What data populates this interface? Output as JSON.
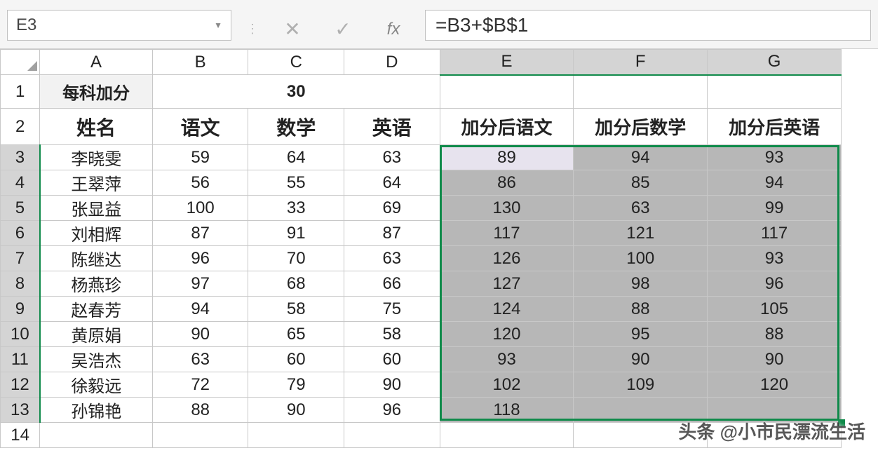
{
  "nameBox": "E3",
  "formula": "=B3+$B$1",
  "fxLabel": "fx",
  "columns": [
    "A",
    "B",
    "C",
    "D",
    "E",
    "F",
    "G"
  ],
  "rowNumbers": [
    "1",
    "2",
    "3",
    "4",
    "5",
    "6",
    "7",
    "8",
    "9",
    "10",
    "11",
    "12",
    "13",
    "14"
  ],
  "row1": {
    "A": "每科加分",
    "BCD": "30"
  },
  "headers": {
    "A": "姓名",
    "B": "语文",
    "C": "数学",
    "D": "英语",
    "E": "加分后语文",
    "F": "加分后数学",
    "G": "加分后英语"
  },
  "students": [
    {
      "name": "李晓雯",
      "b": "59",
      "c": "64",
      "d": "63",
      "e": "89",
      "f": "94",
      "g": "93"
    },
    {
      "name": "王翠萍",
      "b": "56",
      "c": "55",
      "d": "64",
      "e": "86",
      "f": "85",
      "g": "94"
    },
    {
      "name": "张显益",
      "b": "100",
      "c": "33",
      "d": "69",
      "e": "130",
      "f": "63",
      "g": "99"
    },
    {
      "name": "刘相辉",
      "b": "87",
      "c": "91",
      "d": "87",
      "e": "117",
      "f": "121",
      "g": "117"
    },
    {
      "name": "陈继达",
      "b": "96",
      "c": "70",
      "d": "63",
      "e": "126",
      "f": "100",
      "g": "93"
    },
    {
      "name": "杨燕珍",
      "b": "97",
      "c": "68",
      "d": "66",
      "e": "127",
      "f": "98",
      "g": "96"
    },
    {
      "name": "赵春芳",
      "b": "94",
      "c": "58",
      "d": "75",
      "e": "124",
      "f": "88",
      "g": "105"
    },
    {
      "name": "黄原娟",
      "b": "90",
      "c": "65",
      "d": "58",
      "e": "120",
      "f": "95",
      "g": "88"
    },
    {
      "name": "吴浩杰",
      "b": "63",
      "c": "60",
      "d": "60",
      "e": "93",
      "f": "90",
      "g": "90"
    },
    {
      "name": "徐毅远",
      "b": "72",
      "c": "79",
      "d": "90",
      "e": "102",
      "f": "109",
      "g": "120"
    },
    {
      "name": "孙锦艳",
      "b": "88",
      "c": "90",
      "d": "96",
      "e": "118",
      "f": "",
      "g": ""
    }
  ],
  "watermark": "头条 @小市民漂流生活",
  "selection": {
    "startCol": "E",
    "endCol": "G",
    "startRow": 3,
    "endRow": 13,
    "activeCell": "E3"
  }
}
